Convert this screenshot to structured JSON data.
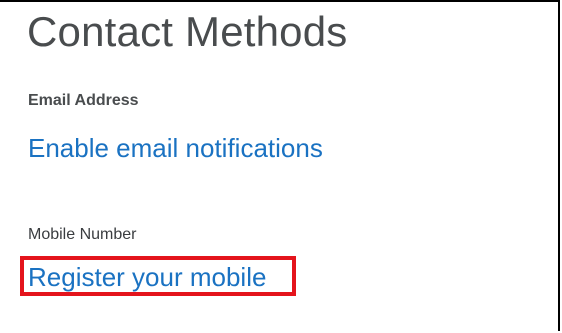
{
  "page": {
    "title": "Contact Methods"
  },
  "email": {
    "label": "Email Address",
    "link": "Enable email notifications"
  },
  "mobile": {
    "label": "Mobile Number",
    "link": "Register your mobile"
  },
  "colors": {
    "link": "#1a72c2",
    "text": "#494c4e",
    "highlight": "#e4141c"
  }
}
